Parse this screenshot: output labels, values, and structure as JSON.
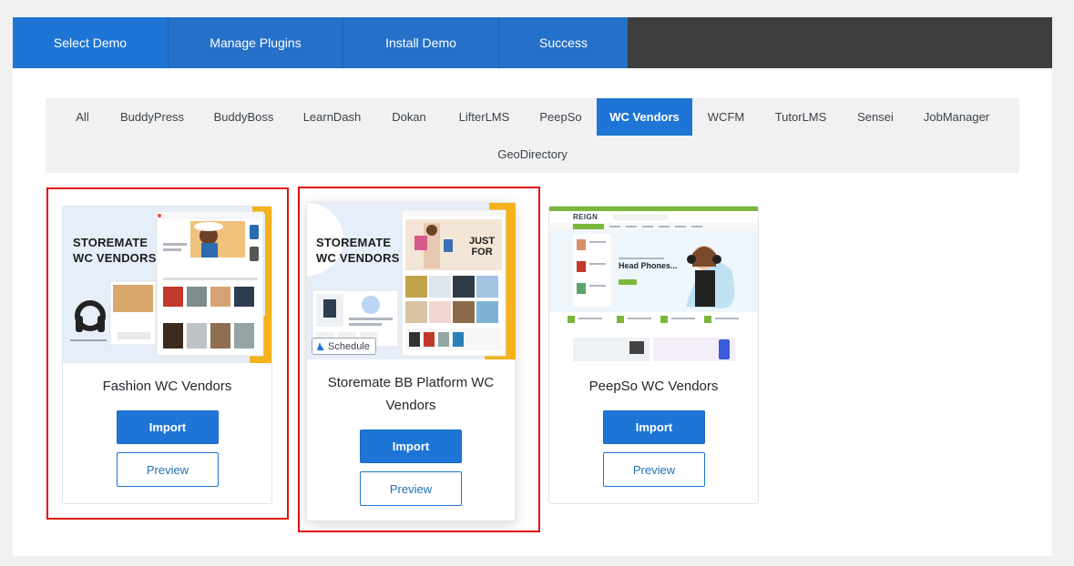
{
  "wizard": {
    "steps": [
      {
        "label": "Select Demo",
        "active": true
      },
      {
        "label": "Manage Plugins",
        "active": false
      },
      {
        "label": "Install Demo",
        "active": false
      },
      {
        "label": "Success",
        "active": false
      }
    ]
  },
  "filters": [
    "All",
    "BuddyPress",
    "BuddyBoss",
    "LearnDash",
    "Dokan",
    "LifterLMS",
    "PeepSo",
    "WC Vendors",
    "WCFM",
    "TutorLMS",
    "Sensei",
    "JobManager",
    "GeoDirectory"
  ],
  "active_filter": "WC Vendors",
  "demos": [
    {
      "title": "Fashion WC Vendors",
      "thumb_heading_1": "STOREMATE",
      "thumb_heading_2": "WC VENDORS",
      "import_label": "Import",
      "preview_label": "Preview"
    },
    {
      "title": "Storemate BB Platform WC Vendors",
      "thumb_heading_1": "STOREMATE",
      "thumb_heading_2": "WC VENDORS",
      "thumb_promo_1": "JUST",
      "thumb_promo_2": "FOR",
      "badge": "Schedule",
      "import_label": "Import",
      "preview_label": "Preview"
    },
    {
      "title": "PeepSo WC Vendors",
      "thumb_logo": "REIGN",
      "thumb_hero": "Head Phones...",
      "import_label": "Import",
      "preview_label": "Preview"
    }
  ],
  "colors": {
    "accent": "#1e75d6",
    "highlight": "#e01010",
    "dark_bar": "#3e3e3e",
    "thumb_bg": "#e6eef9",
    "thumb_yellow": "#f6b21a",
    "reign_green": "#7ab83b"
  }
}
